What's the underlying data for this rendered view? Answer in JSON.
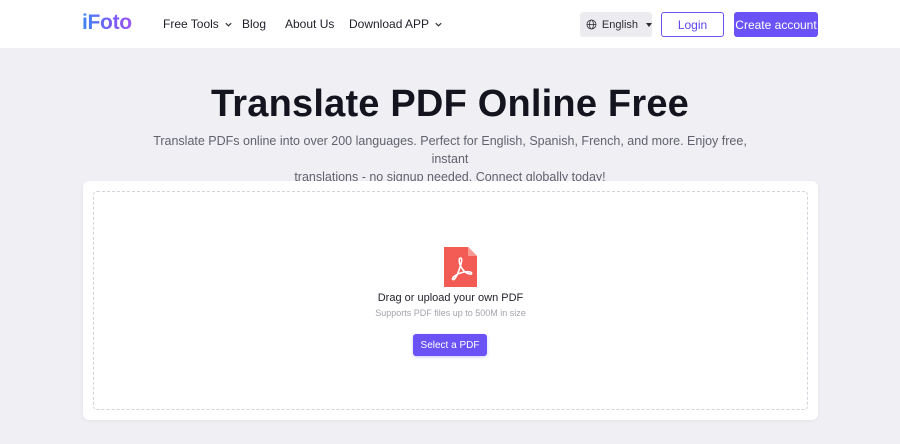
{
  "header": {
    "logo": "iFoto",
    "nav": {
      "free_tools": "Free Tools",
      "blog": "Blog",
      "about": "About Us",
      "download": "Download APP"
    },
    "language": "English",
    "login": "Login",
    "create_account": "Create account"
  },
  "hero": {
    "title": "Translate PDF Online Free",
    "subtitle_line1": "Translate PDFs online into over 200 languages. Perfect for English, Spanish, French, and more. Enjoy free, instant",
    "subtitle_line2": "translations - no signup needed. Connect globally today!"
  },
  "upload": {
    "icon": "pdf-file-icon",
    "drag_text": "Drag or upload your own PDF",
    "support_text": "Supports PDF files up to 500M in size",
    "select_button": "Select a PDF"
  },
  "colors": {
    "accent": "#6b52f6",
    "pdf_red": "#f25c54"
  }
}
